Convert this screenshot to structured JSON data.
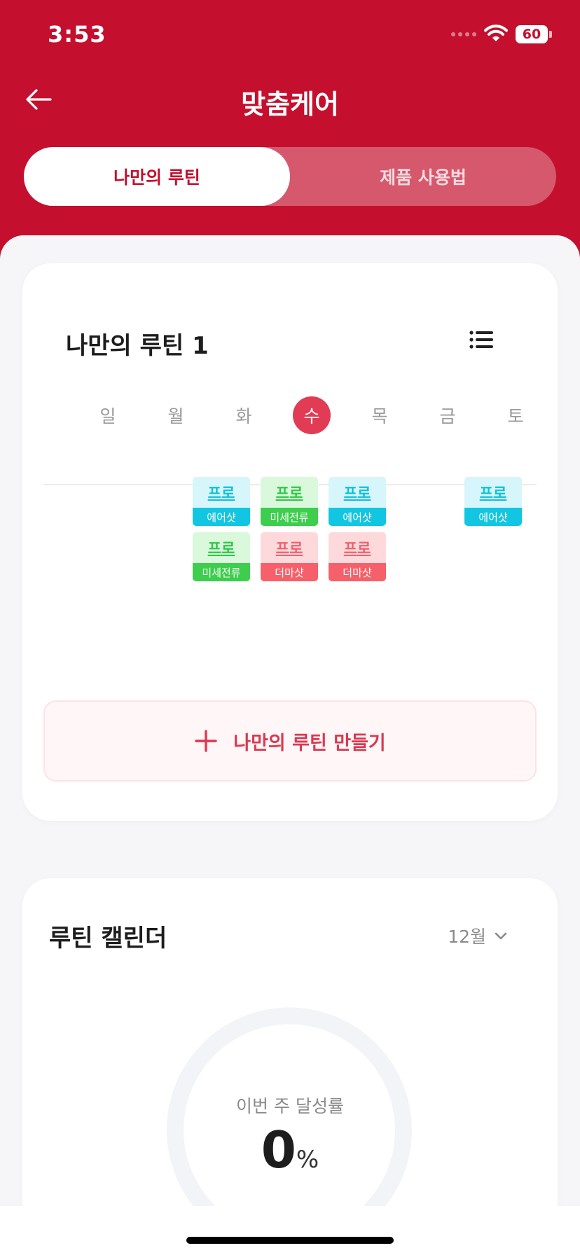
{
  "status_bar": {
    "time": "3:53",
    "battery": "60"
  },
  "header": {
    "title": "맞춤케어"
  },
  "segment": {
    "active": "나만의 루틴",
    "inactive": "제품 사용법"
  },
  "routine": {
    "title": "나만의 루틴 1",
    "days": [
      "일",
      "월",
      "화",
      "수",
      "목",
      "금",
      "토"
    ],
    "selected_day": "수",
    "tiles": [
      {
        "name": "프로",
        "label": "에어샷",
        "color": "cyan"
      },
      {
        "name": "프로",
        "label": "미세전류",
        "color": "green"
      },
      {
        "name": "프로",
        "label": "에어샷",
        "color": "cyan"
      },
      {
        "name": "프로",
        "label": "에어샷",
        "color": "cyan"
      },
      {
        "name": "프로",
        "label": "미세전류",
        "color": "green"
      },
      {
        "name": "프로",
        "label": "더마샷",
        "color": "red"
      },
      {
        "name": "프로",
        "label": "더마샷",
        "color": "red"
      }
    ],
    "make_button": "나만의 루틴 만들기"
  },
  "calendar": {
    "title": "루틴 캘린더",
    "month": "12월",
    "achievement_label": "이번 주 달성률",
    "achievement_value": "0",
    "achievement_unit": "%"
  },
  "colors": {
    "brand": "#c4102e",
    "accent": "#e23b55",
    "cyan": "#12c6e2",
    "green": "#3cce4c",
    "red": "#f6606a"
  }
}
